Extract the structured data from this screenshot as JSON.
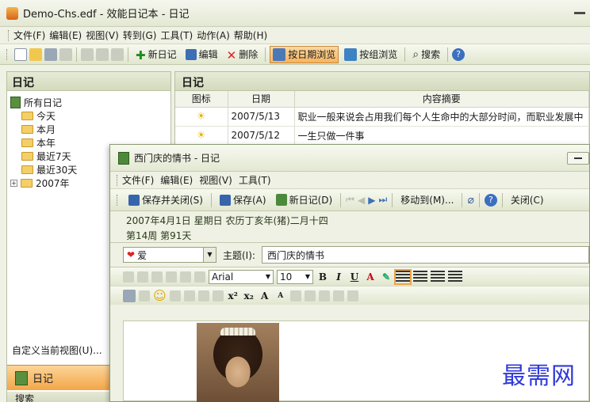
{
  "main_window": {
    "title": "Demo-Chs.edf - 效能日记本 - 日记",
    "menu": [
      "文件(F)",
      "编辑(E)",
      "视图(V)",
      "转到(G)",
      "工具(T)",
      "动作(A)",
      "帮助(H)"
    ],
    "toolbar": {
      "new_diary": "新日记",
      "edit": "编辑",
      "delete": "删除",
      "browse_by_date": "按日期浏览",
      "browse_by_group": "按组浏览",
      "search": "搜索"
    }
  },
  "left_panel": {
    "title": "日记",
    "tree": {
      "root": "所有日记",
      "items": [
        "今天",
        "本月",
        "本年",
        "最近7天",
        "最近30天",
        "2007年"
      ]
    },
    "custom_view": "自定义当前视图(U)...",
    "nav_diary": "日记",
    "nav_search": "搜索"
  },
  "list_panel": {
    "title": "日记",
    "columns": [
      "图标",
      "日期",
      "内容摘要"
    ],
    "rows": [
      {
        "date": "2007/5/13",
        "summary": "职业一般来说会占用我们每个人生命中的大部分时间，而职业发展中"
      },
      {
        "date": "2007/5/12",
        "summary": "一生只做一件事"
      }
    ]
  },
  "editor": {
    "title": "西门庆的情书 - 日记",
    "menu": [
      "文件(F)",
      "编辑(E)",
      "视图(V)",
      "工具(T)"
    ],
    "toolbar": {
      "save_close": "保存并关闭(S)",
      "save": "保存(A)",
      "new_diary": "新日记(D)",
      "move_to": "移动到(M)...",
      "close": "关闭(C)"
    },
    "date_line": "2007年4月1日 星期日 农历丁亥年(猪)二月十四",
    "week_line": "第14周 第91天",
    "mood": "爱",
    "subject_label": "主题(I):",
    "subject_value": "西门庆的情书",
    "format": {
      "font": "Arial",
      "size": "10"
    }
  },
  "watermark": "最需网",
  "colors": {
    "accent_orange": "#f6b45e",
    "watermark_blue": "#2f39d8"
  }
}
